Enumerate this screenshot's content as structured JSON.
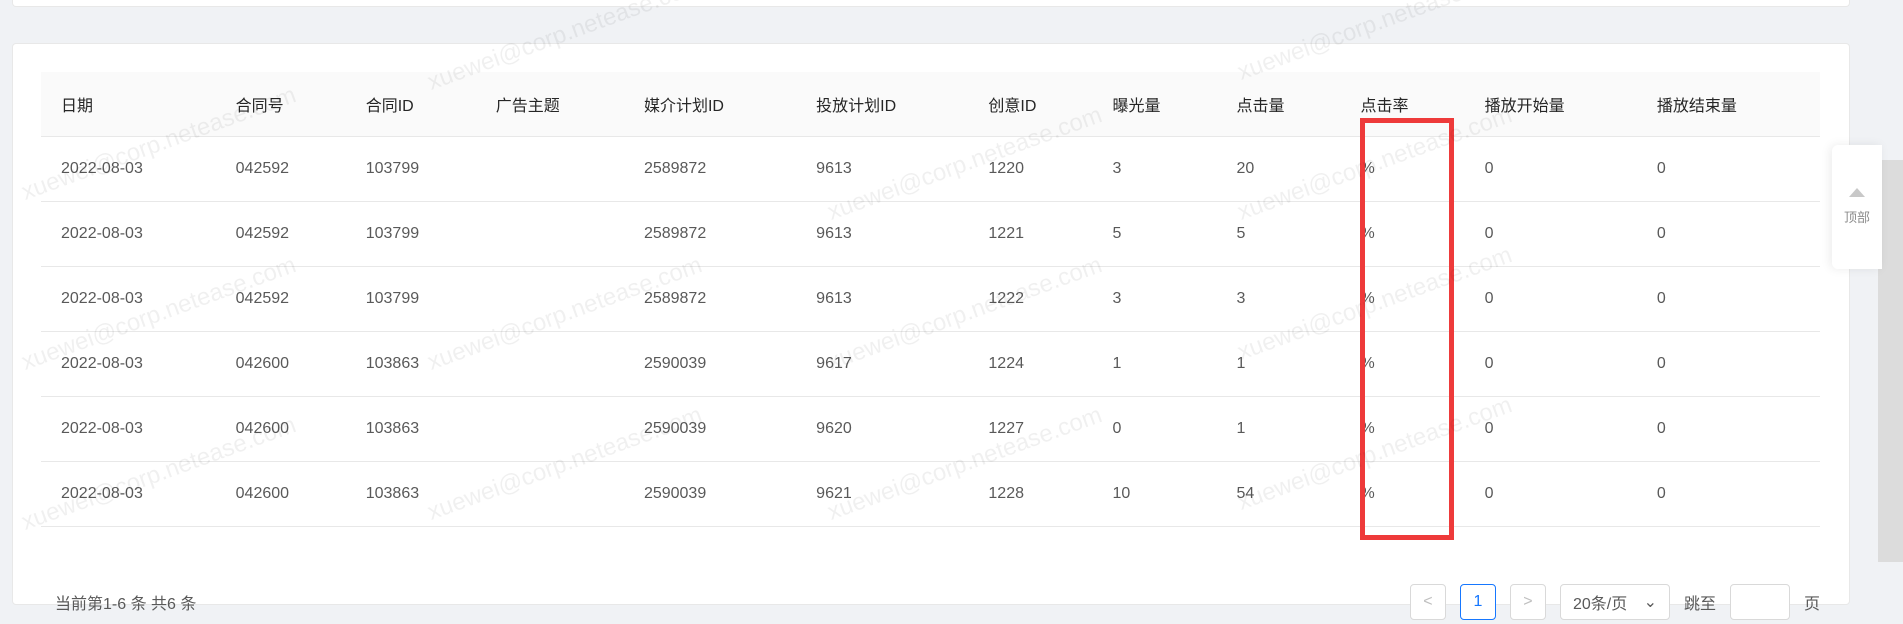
{
  "table": {
    "headers": [
      "日期",
      "合同号",
      "合同ID",
      "广告主题",
      "媒介计划ID",
      "投放计划ID",
      "创意ID",
      "曝光量",
      "点击量",
      "点击率",
      "播放开始量",
      "播放结束量"
    ],
    "rows": [
      [
        "2022-08-03",
        "042592",
        "103799",
        "",
        "2589872",
        "9613",
        "1220",
        "3",
        "20",
        "%",
        "0",
        "0"
      ],
      [
        "2022-08-03",
        "042592",
        "103799",
        "",
        "2589872",
        "9613",
        "1221",
        "5",
        "5",
        "%",
        "0",
        "0"
      ],
      [
        "2022-08-03",
        "042592",
        "103799",
        "",
        "2589872",
        "9613",
        "1222",
        "3",
        "3",
        "%",
        "0",
        "0"
      ],
      [
        "2022-08-03",
        "042600",
        "103863",
        "",
        "2590039",
        "9617",
        "1224",
        "1",
        "1",
        "%",
        "0",
        "0"
      ],
      [
        "2022-08-03",
        "042600",
        "103863",
        "",
        "2590039",
        "9620",
        "1227",
        "0",
        "1",
        "%",
        "0",
        "0"
      ],
      [
        "2022-08-03",
        "042600",
        "103863",
        "",
        "2590039",
        "9621",
        "1228",
        "10",
        "54",
        "%",
        "0",
        "0"
      ]
    ]
  },
  "backtop": {
    "label": "顶部"
  },
  "pagination": {
    "total_text": "当前第1-6 条 共6 条",
    "prev": "<",
    "current": "1",
    "next": ">",
    "page_size": "20条/页",
    "jump_label": "跳至",
    "page_unit": "页"
  },
  "watermark": {
    "text": "xuewei@corp.netease.com"
  },
  "colors": {
    "highlight": "#ee3a3a",
    "accent": "#1677ff"
  }
}
